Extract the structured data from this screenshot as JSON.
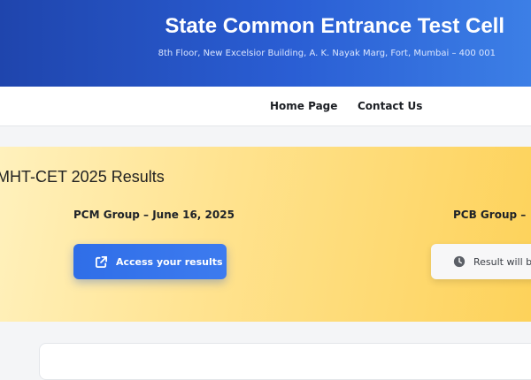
{
  "header": {
    "title": "State Common Entrance Test Cell",
    "address": "8th Floor, New Excelsior Building, A. K. Nayak Marg, Fort, Mumbai – 400 001"
  },
  "nav": {
    "home": "Home Page",
    "contact": "Contact Us"
  },
  "results": {
    "title": "MHT-CET 2025 Results",
    "pcm_heading": "PCM Group – June 16, 2025",
    "pcb_heading": "PCB Group – ",
    "access_button": "Access your results",
    "pending_button": "Result will be"
  },
  "colors": {
    "header_blue": "#2a5ed4",
    "button_blue": "#2f6ee8",
    "panel_yellow": "#ffe390"
  },
  "icons": {
    "access": "external-link-icon",
    "pending": "clock-icon"
  }
}
